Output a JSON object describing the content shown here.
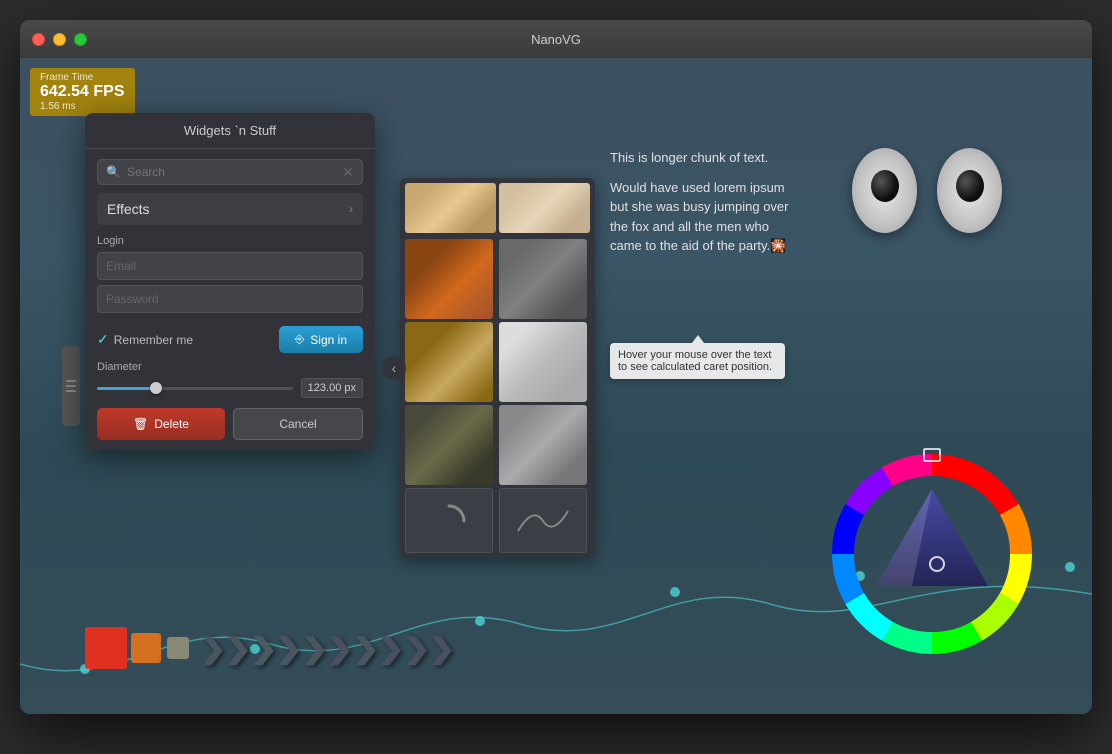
{
  "window": {
    "title": "NanoVG"
  },
  "fps": {
    "label": "Frame Time",
    "value": "642.54 FPS",
    "ms": "1.56 ms"
  },
  "panel": {
    "title": "Widgets `n Stuff",
    "search": {
      "placeholder": "Search",
      "label": "Search"
    },
    "effects": {
      "label": "Effects"
    },
    "login": {
      "label": "Login",
      "email_placeholder": "Email",
      "password_placeholder": "Password",
      "remember_label": "Remember me",
      "signin_label": "Sign in"
    },
    "diameter": {
      "label": "Diameter",
      "value": "123.00 px"
    },
    "delete_label": "Delete",
    "cancel_label": "Cancel"
  },
  "text_block": {
    "paragraph1": "This is longer chunk of text.",
    "paragraph2": "Would have used lorem ipsum but she   was busy jumping over the fox and all the men who came to the aid of the party.🎇"
  },
  "tooltip": {
    "text": "Hover your mouse over the text to see calculated caret position."
  },
  "colors": {
    "red": "#e03020",
    "orange": "#d47020",
    "gray": "#888877"
  }
}
